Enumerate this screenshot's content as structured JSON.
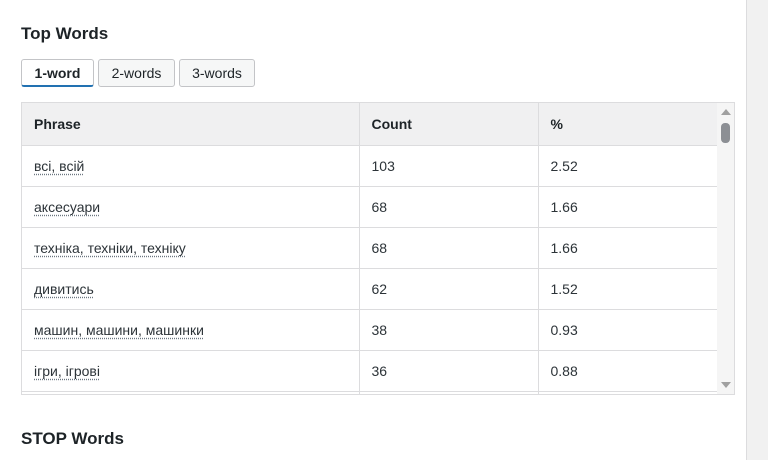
{
  "top_words": {
    "title": "Top Words",
    "tabs": [
      {
        "label": "1-word",
        "active": true
      },
      {
        "label": "2-words",
        "active": false
      },
      {
        "label": "3-words",
        "active": false
      }
    ],
    "table": {
      "headers": [
        "Phrase",
        "Count",
        "%"
      ],
      "rows": [
        {
          "phrase": "всі, всій",
          "count": "103",
          "percent": "2.52"
        },
        {
          "phrase": "аксесуари",
          "count": "68",
          "percent": "1.66"
        },
        {
          "phrase": "техніка, техніки, техніку",
          "count": "68",
          "percent": "1.66"
        },
        {
          "phrase": "дивитись",
          "count": "62",
          "percent": "1.52"
        },
        {
          "phrase": "машин, машини, машинки",
          "count": "38",
          "percent": "0.93"
        },
        {
          "phrase": "ігри, ігрові",
          "count": "36",
          "percent": "0.88"
        },
        {
          "phrase": "",
          "count": "",
          "percent": ""
        }
      ]
    }
  },
  "stop_words": {
    "title": "STOP Words"
  },
  "colors": {
    "accent": "#2271b1",
    "border": "#dcdcde",
    "header_bg": "#f0f0f1"
  }
}
